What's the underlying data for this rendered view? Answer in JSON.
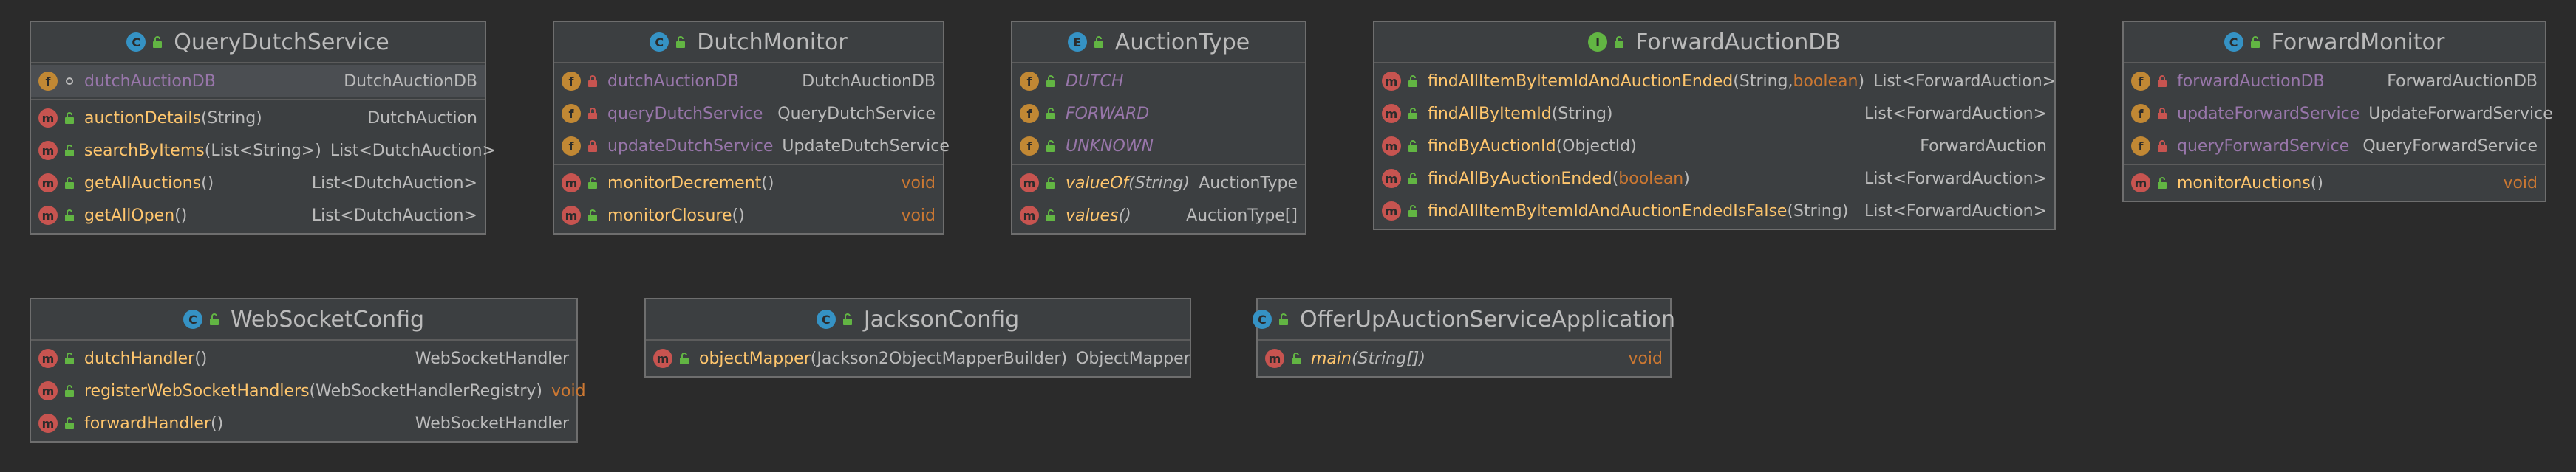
{
  "boxes": [
    {
      "title": "QueryDutchService",
      "kind": "C",
      "fields": [
        {
          "name": "dutchAuctionDB",
          "type": "DutchAuctionDB",
          "vis": "package"
        }
      ],
      "methods": [
        {
          "name": "auctionDetails",
          "params": "(String)",
          "type": "DutchAuction"
        },
        {
          "name": "searchByItems",
          "params": "(List<String>)",
          "type": "List<DutchAuction>"
        },
        {
          "name": "getAllAuctions",
          "params": "()",
          "type": "List<DutchAuction>"
        },
        {
          "name": "getAllOpen",
          "params": "()",
          "type": "List<DutchAuction>"
        }
      ]
    },
    {
      "title": "DutchMonitor",
      "kind": "C",
      "fields": [
        {
          "name": "dutchAuctionDB",
          "type": "DutchAuctionDB",
          "vis": "private"
        },
        {
          "name": "queryDutchService",
          "type": "QueryDutchService",
          "vis": "private"
        },
        {
          "name": "updateDutchService",
          "type": "UpdateDutchService",
          "vis": "private"
        }
      ],
      "methods": [
        {
          "name": "monitorDecrement",
          "params": "()",
          "type": "void"
        },
        {
          "name": "monitorClosure",
          "params": "()",
          "type": "void"
        }
      ]
    },
    {
      "title": "AuctionType",
      "kind": "E",
      "fields": [
        {
          "name": "DUTCH",
          "type": "",
          "vis": "public"
        },
        {
          "name": "FORWARD",
          "type": "",
          "vis": "public"
        },
        {
          "name": "UNKNOWN",
          "type": "",
          "vis": "public"
        }
      ],
      "methods": [
        {
          "name": "valueOf",
          "params": "(String)",
          "type": "AuctionType",
          "static": true
        },
        {
          "name": "values",
          "params": "()",
          "type": "AuctionType[]",
          "static": true
        }
      ]
    },
    {
      "title": "ForwardAuctionDB",
      "kind": "I",
      "fields": [],
      "methods": [
        {
          "name": "findAllItemByItemIdAndAuctionEnded",
          "params": "(String, ",
          "params_kw": "boolean",
          "params_end": ")",
          "type": "List<ForwardAuction>"
        },
        {
          "name": "findAllByItemId",
          "params": "(String)",
          "type": "List<ForwardAuction>"
        },
        {
          "name": "findByAuctionId",
          "params": "(ObjectId)",
          "type": "ForwardAuction"
        },
        {
          "name": "findAllByAuctionEnded",
          "params": "(",
          "params_kw": "boolean",
          "params_end": ")",
          "type": "List<ForwardAuction>"
        },
        {
          "name": "findAllItemByItemIdAndAuctionEndedIsFalse",
          "params": "(String)",
          "type": "List<ForwardAuction>"
        }
      ]
    },
    {
      "title": "ForwardMonitor",
      "kind": "C",
      "fields": [
        {
          "name": "forwardAuctionDB",
          "type": "ForwardAuctionDB",
          "vis": "private"
        },
        {
          "name": "updateForwardService",
          "type": "UpdateForwardService",
          "vis": "private"
        },
        {
          "name": "queryForwardService",
          "type": "QueryForwardService",
          "vis": "private"
        }
      ],
      "methods": [
        {
          "name": "monitorAuctions",
          "params": "()",
          "type": "void"
        }
      ]
    },
    {
      "title": "WebSocketConfig",
      "kind": "C",
      "fields": [],
      "methods": [
        {
          "name": "dutchHandler",
          "params": "()",
          "type": "WebSocketHandler"
        },
        {
          "name": "registerWebSocketHandlers",
          "params": "(WebSocketHandlerRegistry)",
          "type": "void"
        },
        {
          "name": "forwardHandler",
          "params": "()",
          "type": "WebSocketHandler"
        }
      ]
    },
    {
      "title": "JacksonConfig",
      "kind": "C",
      "fields": [],
      "methods": [
        {
          "name": "objectMapper",
          "params": "(Jackson2ObjectMapperBuilder)",
          "type": "ObjectMapper"
        }
      ]
    },
    {
      "title": "OfferUpAuctionServiceApplication",
      "kind": "C",
      "fields": [],
      "methods": [
        {
          "name": "main",
          "params": "(String[])",
          "type": "void",
          "static": true
        }
      ]
    }
  ],
  "colors": {
    "background": "#2b2b2b",
    "box": "#3c3f41",
    "field": "#9876aa",
    "method": "#ffc66d",
    "keyword": "#cc7832"
  }
}
